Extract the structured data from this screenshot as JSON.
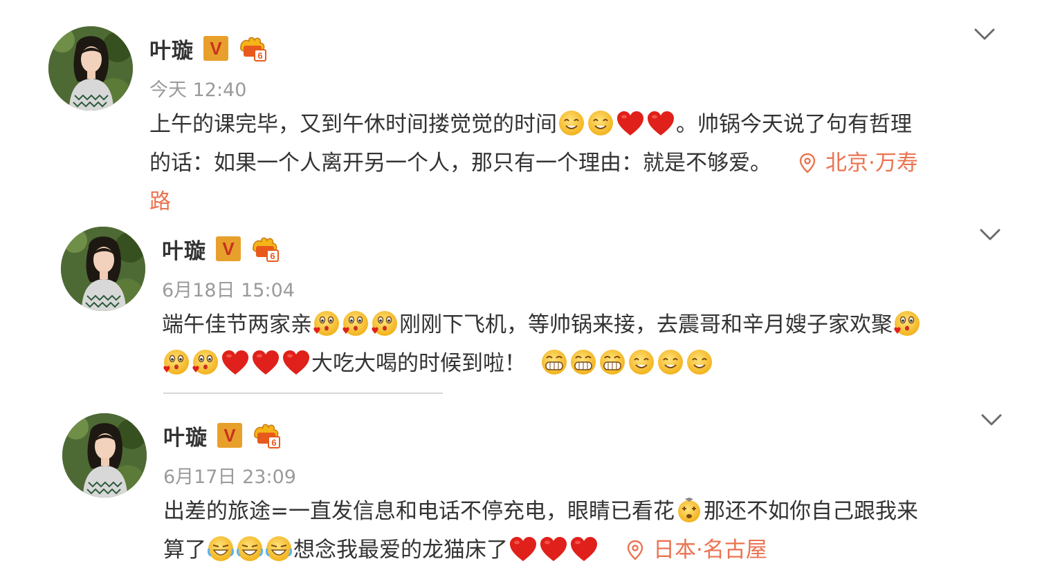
{
  "posts": [
    {
      "user": "叶璇",
      "verified": "V",
      "time": "今天 12:40",
      "text_a": "上午的课完毕，又到午休时间搂觉觉的时间",
      "text_b": "。帅锅今天说了句有哲理",
      "text_c": "的话：如果一个人离开另一个人，那只有一个理由：就是不够爱。",
      "location_a": "北京·万寿",
      "location_b": "路"
    },
    {
      "user": "叶璇",
      "verified": "V",
      "time": "6月18日 15:04",
      "text_a": "端午佳节两家亲",
      "text_b": "刚刚下飞机，等帅锅来接，去震哥和辛月嫂子家欢聚",
      "text_c": "大吃大喝的时候到啦！"
    },
    {
      "user": "叶璇",
      "verified": "V",
      "time": "6月17日 23:09",
      "text_a": "出差的旅途=一直发信息和电话不停充电，眼睛已看花",
      "text_b": "那还不如你自己跟我来",
      "text_c": "算了",
      "text_d": "想念我最爱的龙猫床了",
      "location_a": "日本·名古屋"
    }
  ],
  "icons": [
    "avatar",
    "verified-v-icon",
    "level-badge-icon",
    "chevron-down-icon",
    "location-pin-icon",
    "heart-emoji",
    "smile-emoji",
    "kiss-emoji",
    "grin-emoji",
    "laugh-cry-emoji",
    "dizzy-emoji"
  ],
  "colors": {
    "text": "#333333",
    "time": "#9a9a9a",
    "location": "#eb7350",
    "heart": "#e0201a",
    "emoji": "#f5c33b",
    "badge": "#e8a02c"
  }
}
